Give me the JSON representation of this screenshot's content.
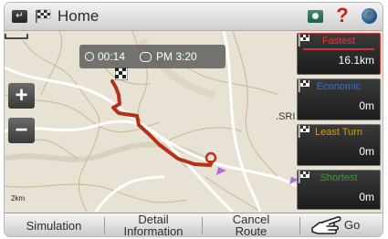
{
  "topbar": {
    "title": "Home",
    "back_icon": "back-arrow-icon",
    "flag_icon": "checkered-flag-icon",
    "help_glyph": "?"
  },
  "map": {
    "eta_time": "00:14",
    "remaining": "PM 3:20",
    "scale_label": "2km",
    "place_label": ".SRI",
    "zoom_in_label": "+",
    "zoom_out_label": "−"
  },
  "route_options": [
    {
      "name": "Fastest",
      "distance": "16.1km",
      "color": "#e23a3a"
    },
    {
      "name": "Economic",
      "distance": "0m",
      "color": "#3c72c8"
    },
    {
      "name": "Least Turn",
      "distance": "0m",
      "color": "#d59a1b"
    },
    {
      "name": "Shortest",
      "distance": "0m",
      "color": "#3d9a3d"
    }
  ],
  "bottombar": {
    "simulation": "Simulation",
    "detail_line1": "Detail",
    "detail_line2": "Information",
    "cancel_line1": "Cancel",
    "cancel_line2": "Route",
    "go": "Go"
  },
  "colors": {
    "route": "#b5301c",
    "map_background": "#e7e2d3",
    "road": "#ffffff",
    "minor_road": "#c7b98f"
  }
}
